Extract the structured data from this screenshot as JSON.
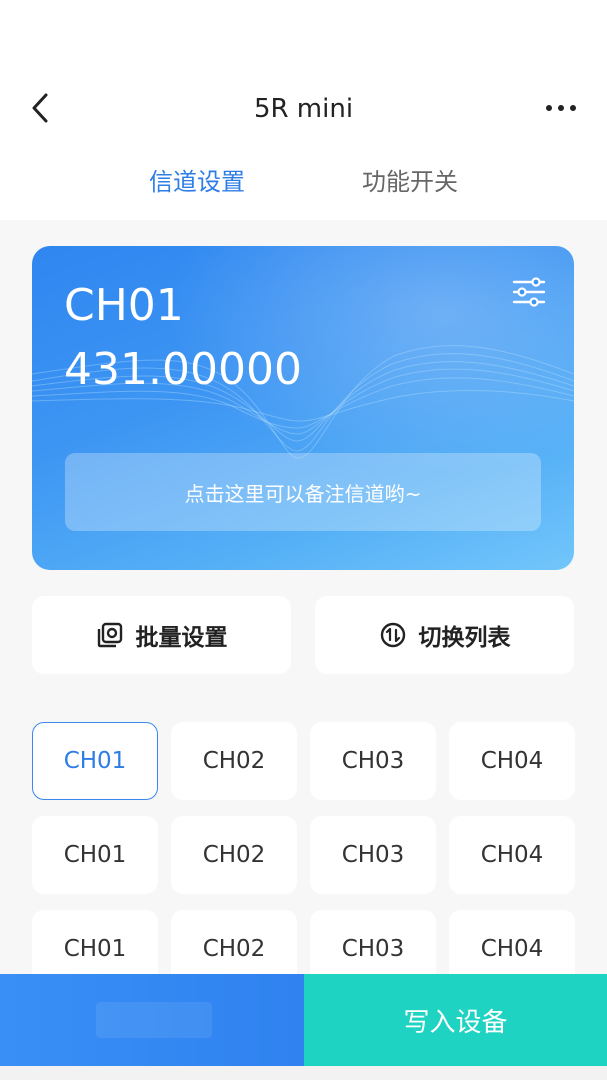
{
  "header": {
    "title": "5R mini",
    "tabs": [
      {
        "label": "信道设置",
        "active": true
      },
      {
        "label": "功能开关",
        "active": false
      }
    ]
  },
  "card": {
    "channel": "CH01",
    "frequency": "431.00000",
    "note_placeholder": "点击这里可以备注信道哟~"
  },
  "actions": {
    "batch_label": "批量设置",
    "switch_label": "切换列表"
  },
  "channels": [
    [
      "CH01",
      "CH02",
      "CH03",
      "CH04"
    ],
    [
      "CH01",
      "CH02",
      "CH03",
      "CH04"
    ],
    [
      "CH01",
      "CH02",
      "CH03",
      "CH04"
    ]
  ],
  "bottom": {
    "write_label": "写入设备"
  },
  "colors": {
    "accent": "#2e7de6",
    "teal": "#1fd3c3"
  }
}
